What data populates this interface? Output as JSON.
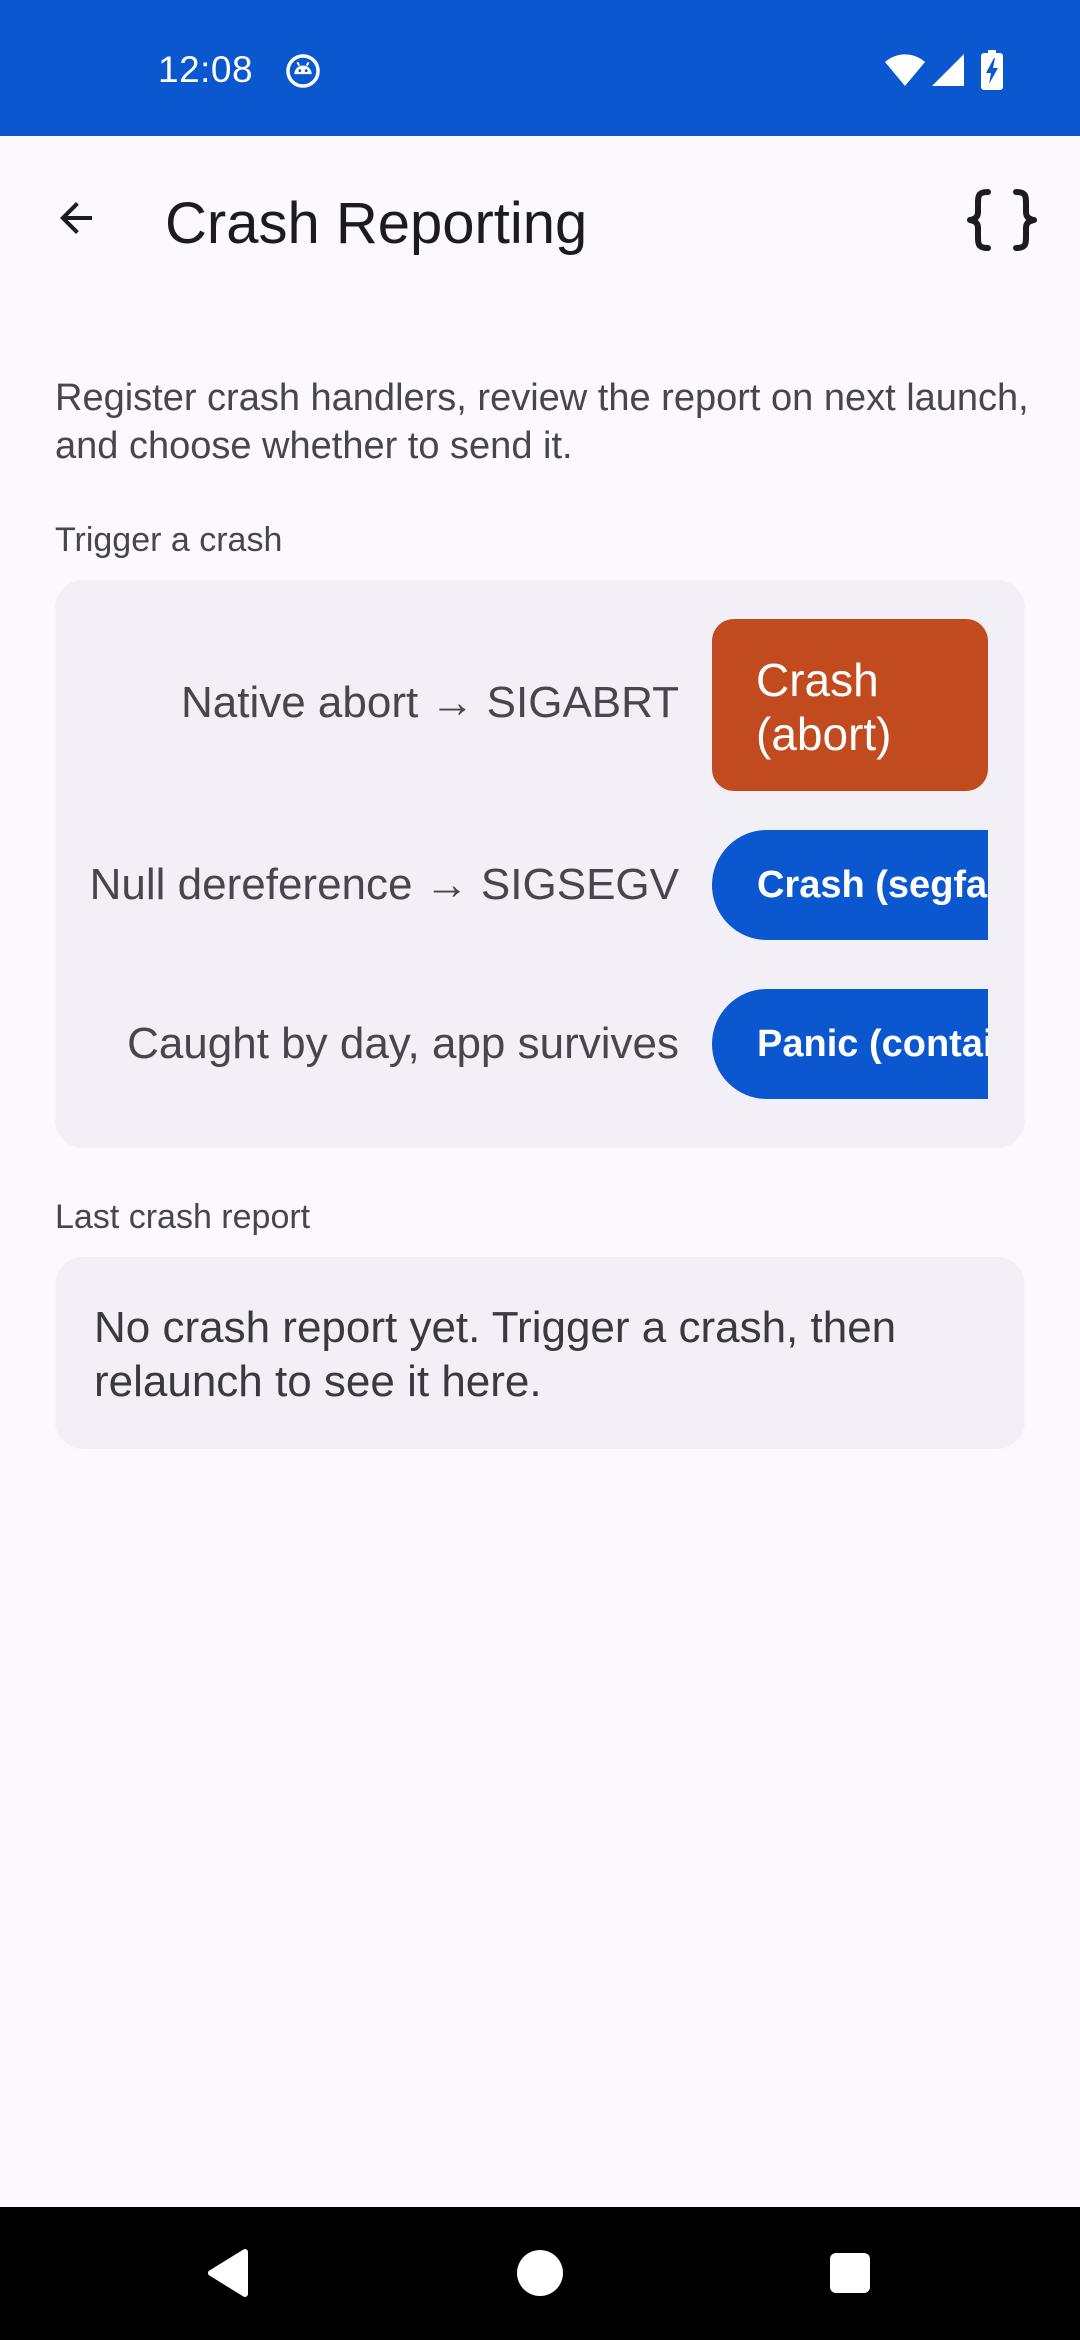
{
  "status_bar": {
    "time": "12:08",
    "app_icon": "android-debug-icon",
    "icons": [
      "wifi-icon",
      "signal-icon",
      "battery-charging-icon"
    ],
    "background_color": "#0b57d0"
  },
  "app_bar": {
    "title": "Crash Reporting",
    "back_icon": "arrow-back-icon",
    "action_icon": "curly-braces-icon"
  },
  "intro": "Register crash handlers, review the report on next launch, and choose whether to send it.",
  "trigger_section": {
    "label": "Trigger a crash",
    "rows": [
      {
        "label": "Native abort → SIGABRT",
        "button": "Crash (abort)",
        "button_color": "#c24a1f"
      },
      {
        "label": "Null dereference → SIGSEGV",
        "button": "Crash (segfau",
        "button_color": "#0b57d0"
      },
      {
        "label": "Caught by day, app survives",
        "button": "Panic (contai",
        "button_color": "#0b57d0"
      }
    ]
  },
  "report_section": {
    "label": "Last crash report",
    "text": "No crash report yet. Trigger a crash, then relaunch to see it here."
  },
  "nav_bar": {
    "buttons": [
      "back-triangle-icon",
      "home-circle-icon",
      "recents-square-icon"
    ]
  }
}
